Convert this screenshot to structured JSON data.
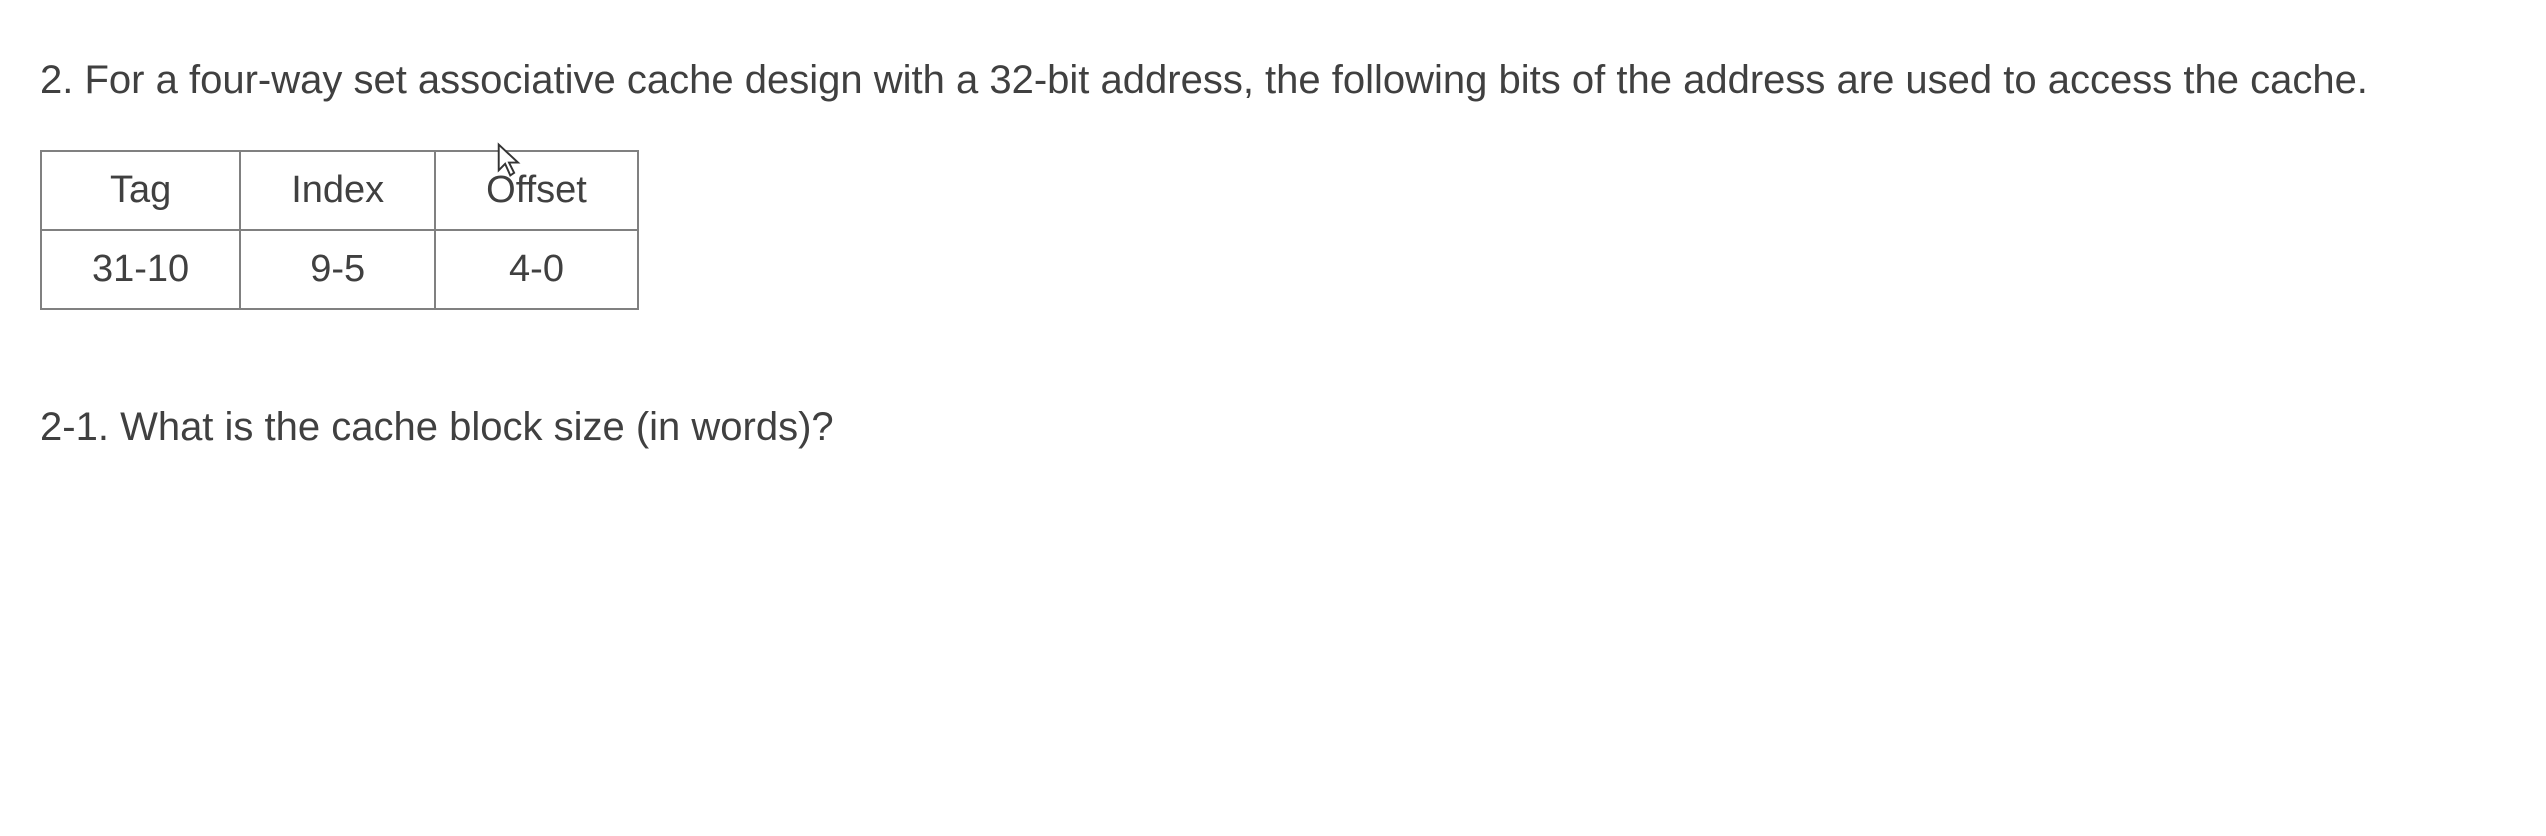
{
  "question": {
    "number": "2.",
    "text": "For a four-way set associative cache design with a 32-bit address, the following bits of the address are used to access the cache."
  },
  "table": {
    "headers": [
      "Tag",
      "Index",
      "Offset"
    ],
    "values": [
      "31-10",
      "9-5",
      "4-0"
    ]
  },
  "sub_question": {
    "number": "2-1.",
    "text": "What is the cache block size (in words)?"
  }
}
